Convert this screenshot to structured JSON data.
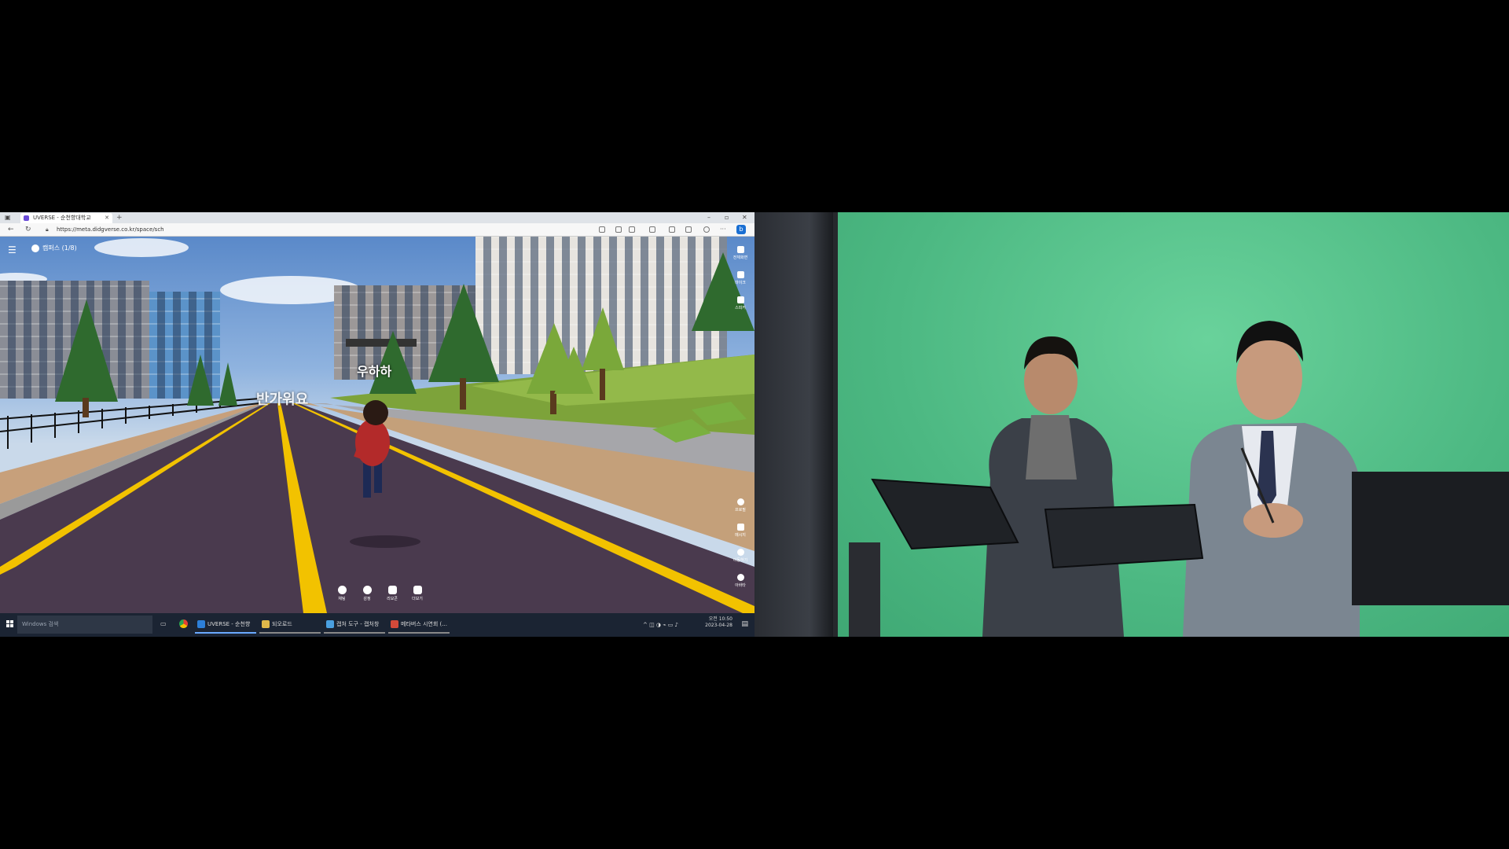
{
  "browser": {
    "tab_title": "UVERSE - 순천향대학교",
    "new_tab": "+",
    "url": "https://meta.didgverse.co.kr/space/sch",
    "window_min": "–",
    "window_max": "▫",
    "window_close": "✕",
    "more": "···",
    "bing": "b"
  },
  "game": {
    "menu_icon": "menu-icon",
    "channel_label": "캠퍼스 (1/8)",
    "player_name": "우하하",
    "chat_bubble": "반가워요",
    "right_rail_top": [
      {
        "icon": "fullscreen-icon",
        "label": "전체화면"
      },
      {
        "icon": "mic-icon",
        "label": "마이크"
      },
      {
        "icon": "speaker-icon",
        "label": "스피커"
      }
    ],
    "right_rail_bottom": [
      {
        "icon": "profile-icon",
        "label": "프로필"
      },
      {
        "icon": "mail-icon",
        "label": "메시지"
      },
      {
        "icon": "map-pin-icon",
        "label": "이동하기"
      },
      {
        "icon": "user-icon",
        "label": "아바타"
      }
    ],
    "bottom_bar": [
      {
        "icon": "chat-icon",
        "label": "채팅"
      },
      {
        "icon": "emotion-icon",
        "label": "감정"
      },
      {
        "icon": "vote-icon",
        "label": "리모콘"
      },
      {
        "icon": "grid-icon",
        "label": "더보기"
      }
    ]
  },
  "taskbar": {
    "search_placeholder": "Windows 검색",
    "items": [
      {
        "label": "UVERSE - 순천향대...",
        "color": "#2d7fd8"
      },
      {
        "label": "되오로드",
        "color": "#e0b84a"
      },
      {
        "label": "캡처 도구 - 캡처창",
        "color": "#4aa0e0"
      },
      {
        "label": "메타버스 시연회 (...",
        "color": "#d24a3a"
      }
    ],
    "time": "오전 10:50",
    "date": "2023-04-28"
  },
  "colors": {
    "road": "#4a3a4e",
    "lane_yellow": "#f2c200",
    "greenscreen": "#4fc08a"
  }
}
